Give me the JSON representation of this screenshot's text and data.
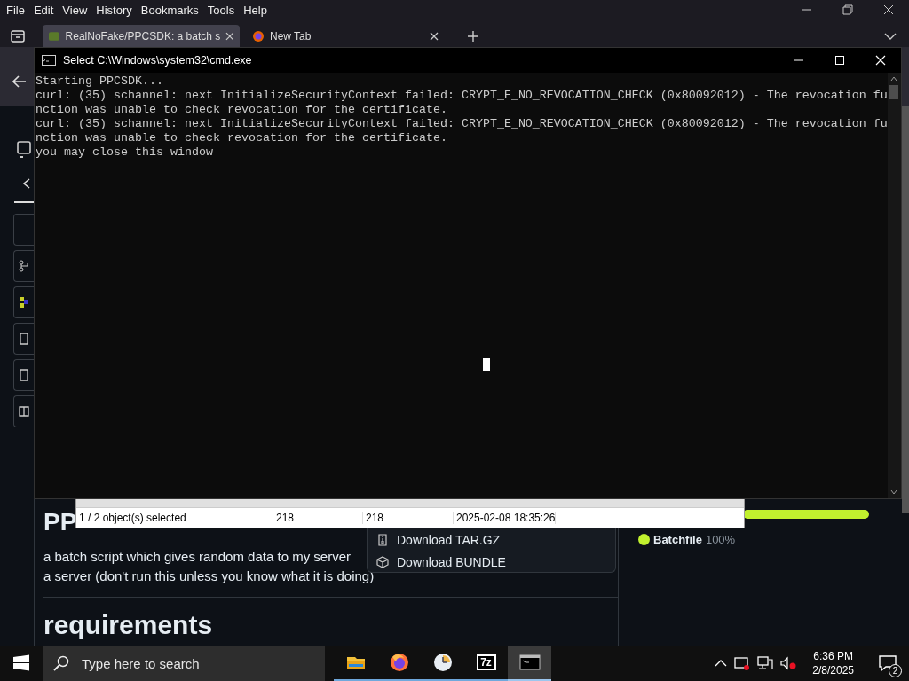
{
  "browser": {
    "menu": [
      "File",
      "Edit",
      "View",
      "History",
      "Bookmarks",
      "Tools",
      "Help"
    ],
    "tabs": [
      {
        "title": "RealNoFake/PPCSDK: a batch s",
        "selected": true
      },
      {
        "title": "New Tab",
        "selected": false
      }
    ],
    "page": {
      "heading": "PP",
      "description": [
        "a batch script which gives random data to my server",
        "a server (don't run this unless you know what it is doing)"
      ],
      "section_heading": "requirements",
      "download_menu": [
        {
          "kind": "archive",
          "label": "Download TAR.GZ"
        },
        {
          "kind": "package",
          "label": "Download BUNDLE"
        }
      ],
      "languages": [
        {
          "name": "Batchfile",
          "percent": "100%",
          "color": "#c1f12e",
          "level": 1
        }
      ]
    }
  },
  "archive_window": {
    "status_cells": [
      "1 / 2 object(s) selected",
      "218",
      "218",
      "2025-02-08 18:35:26"
    ]
  },
  "console_window": {
    "title": "Select C:\\Windows\\system32\\cmd.exe",
    "lines": [
      "Starting PPCSDK...",
      "curl: (35) schannel: next InitializeSecurityContext failed: CRYPT_E_NO_REVOCATION_CHECK (0x80092012) - The revocation fu",
      "nction was unable to check revocation for the certificate.",
      "curl: (35) schannel: next InitializeSecurityContext failed: CRYPT_E_NO_REVOCATION_CHECK (0x80092012) - The revocation fu",
      "nction was unable to check revocation for the certificate.",
      "you may close this window"
    ]
  },
  "taskbar": {
    "search_placeholder": "Type here to search",
    "apps": [
      {
        "kind": "folder",
        "active": false
      },
      {
        "kind": "firefox",
        "active": false
      },
      {
        "kind": "clock",
        "active": false
      },
      {
        "kind": "sevenzip",
        "label": "7z",
        "active": false
      },
      {
        "kind": "console",
        "active": true
      }
    ],
    "time": "6:36 PM",
    "date": "2/8/2025",
    "notification_count": "2"
  }
}
